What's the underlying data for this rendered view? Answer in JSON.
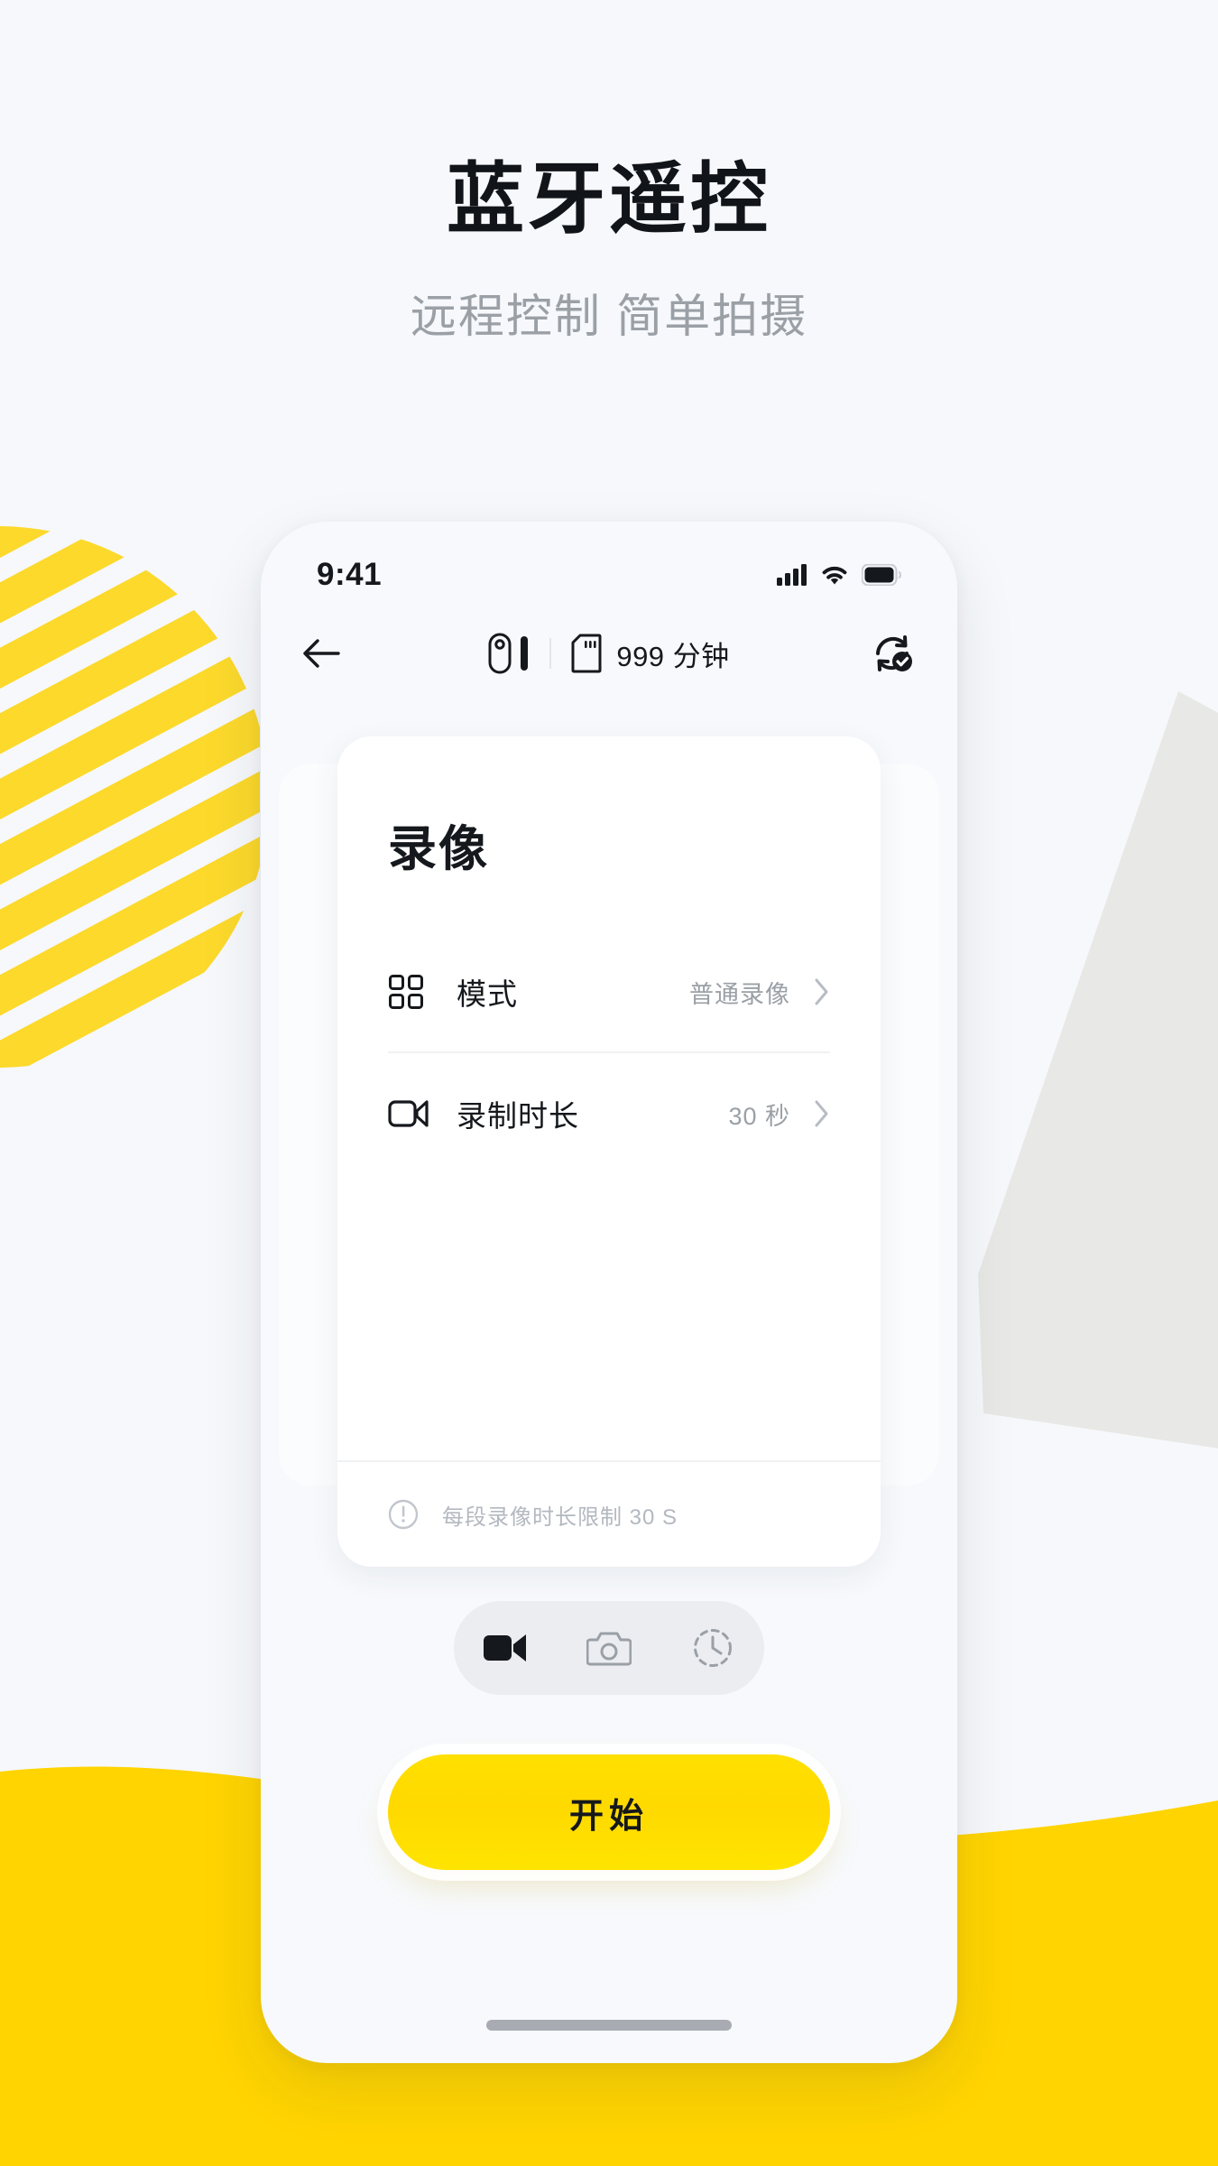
{
  "hero": {
    "title": "蓝牙遥控",
    "subtitle": "远程控制 简单拍摄"
  },
  "colors": {
    "page_bg": "#f6f8fb",
    "accent_yellow": "#ffd400",
    "stripe_yellow": "#fcd92b",
    "grey_shape": "#e8e8e6",
    "text_primary": "#15181c",
    "text_muted": "#9aa0a6"
  },
  "phone": {
    "status_bar": {
      "time": "9:41",
      "icons": [
        "cellular-signal-icon",
        "wifi-icon",
        "battery-icon"
      ]
    },
    "nav_bar": {
      "back_icon": "arrow-left-icon",
      "device_icon": "camera-device-icon",
      "device_battery_icon": "battery-bar-icon",
      "storage_icon": "sd-card-icon",
      "storage_text": "999 分钟",
      "sync_icon": "sync-check-icon"
    },
    "card": {
      "title": "录像",
      "rows": [
        {
          "icon": "grid-icon",
          "label": "模式",
          "value": "普通录像",
          "chevron": "chevron-right-icon"
        },
        {
          "icon": "video-camera-icon",
          "label": "录制时长",
          "value": "30 秒",
          "chevron": "chevron-right-icon"
        }
      ],
      "footer": {
        "icon": "info-circle-icon",
        "text": "每段录像时长限制 30 S"
      }
    },
    "mode_switcher": {
      "items": [
        {
          "icon": "video-filled-icon",
          "name": "video",
          "active": true
        },
        {
          "icon": "camera-icon",
          "name": "photo",
          "active": false
        },
        {
          "icon": "timer-clock-icon",
          "name": "timelapse",
          "active": false
        }
      ]
    },
    "start_button": {
      "label": "开始"
    },
    "home_indicator": "home-indicator-bar"
  }
}
